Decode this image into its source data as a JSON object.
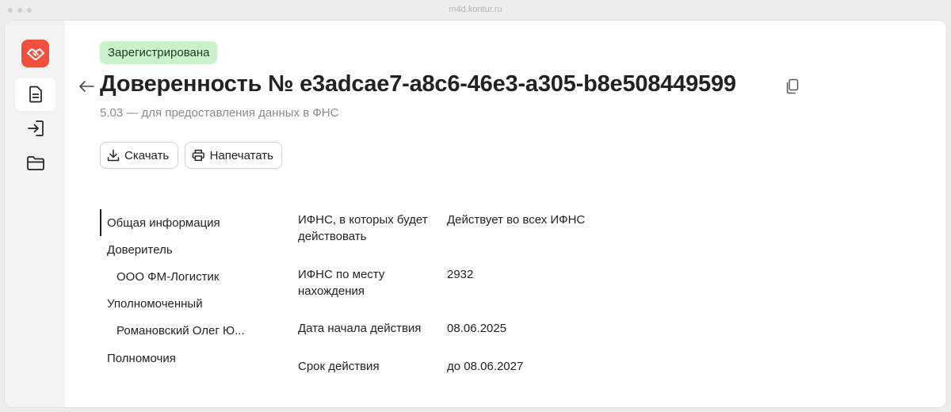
{
  "browser": {
    "url": "m4d.kontur.ru"
  },
  "sidebar": {
    "logo_icon": "handshake-icon",
    "brand_color": "#f0503c",
    "items": [
      {
        "icon": "document-icon",
        "active": true
      },
      {
        "icon": "sign-in-icon",
        "active": false
      },
      {
        "icon": "folder-icon",
        "active": false
      }
    ]
  },
  "header": {
    "status_badge": "Зарегистрирована",
    "status_color": "#c9f2cb",
    "title": "Доверенность № e3adcae7-a8c6-46e3-a305-b8e508449599",
    "subtitle": "5.03 — для предоставления данных в ФНС"
  },
  "actions": {
    "download_label": "Скачать",
    "print_label": "Напечатать"
  },
  "toc": {
    "items": [
      {
        "label": "Общая информация",
        "active": true
      },
      {
        "label": "Доверитель"
      },
      {
        "label": "ООО ФМ-Логистик"
      },
      {
        "label": "Уполномоченный"
      },
      {
        "label": "Романовский Олег Ю..."
      },
      {
        "label": "Полномочия"
      }
    ]
  },
  "general_info": {
    "fields": [
      {
        "label": "ИФНС, в которых будет действовать",
        "value": "Действует во всех ИФНС"
      },
      {
        "label": "ИФНС по месту нахождения",
        "value": "2932"
      },
      {
        "label": "Дата начала действия",
        "value": "08.06.2025"
      },
      {
        "label": "Срок действия",
        "value": "до 08.06.2027"
      }
    ]
  }
}
